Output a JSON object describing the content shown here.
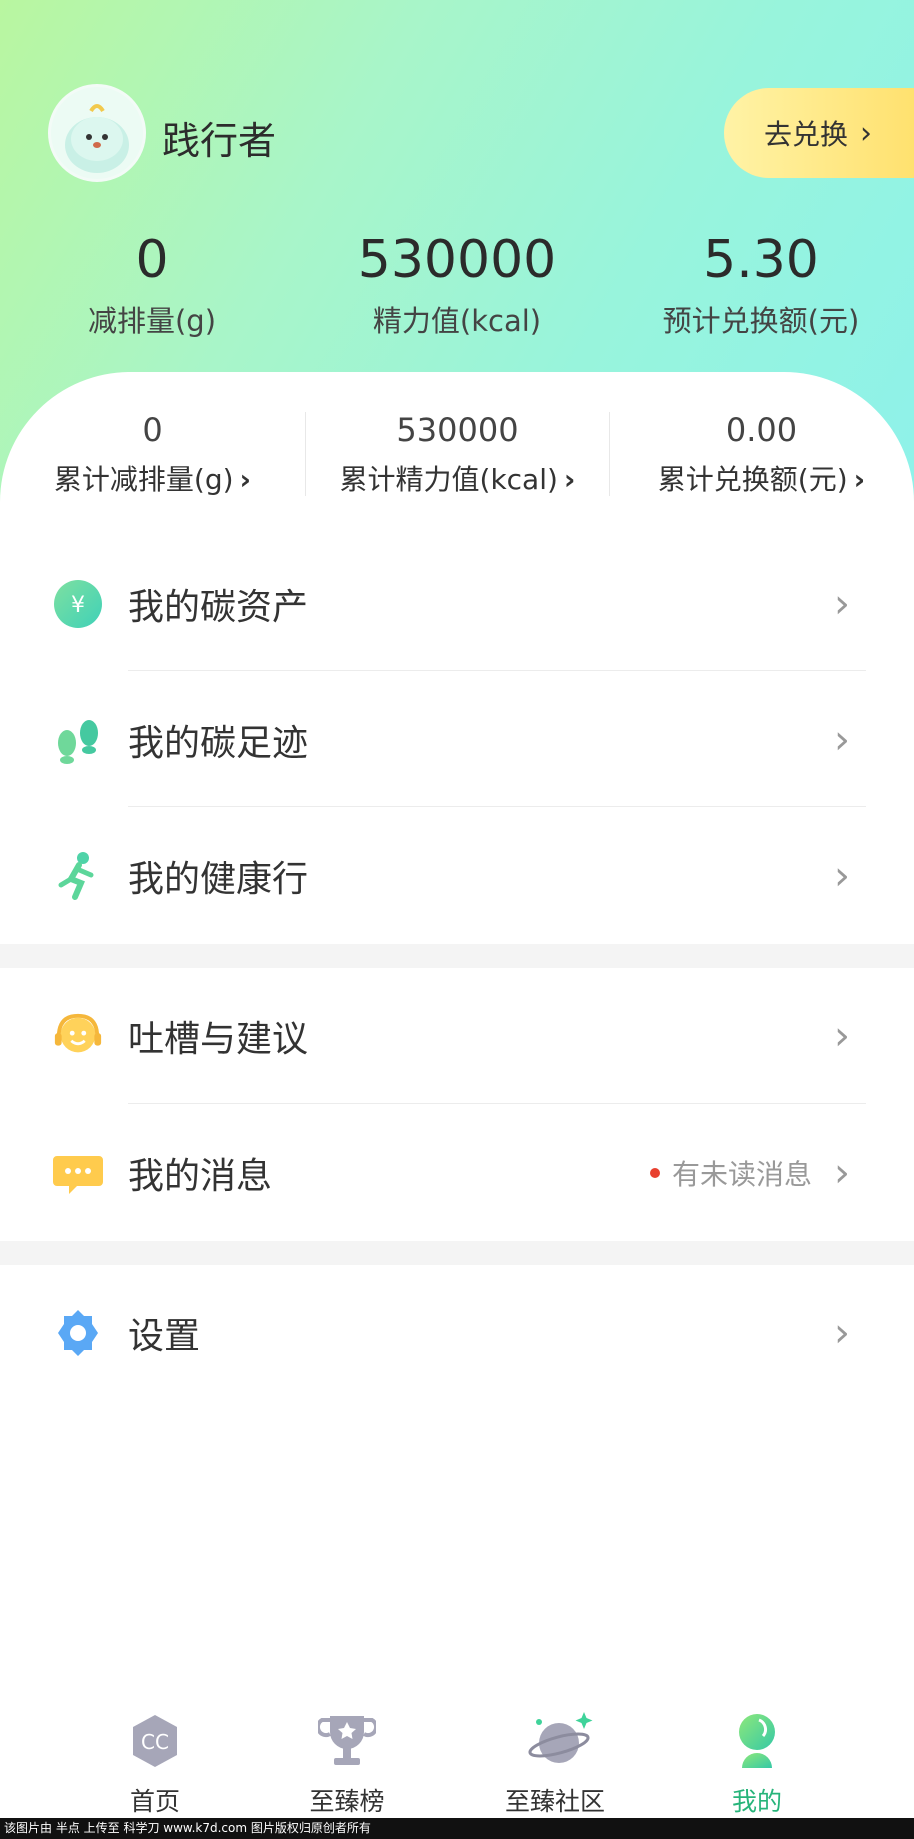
{
  "header": {
    "username": "践行者",
    "redeem_label": "去兑换",
    "colors": {
      "gradient_start": "#b9f6a0",
      "gradient_end": "#8ef2ea",
      "redeem": "#ffe06c"
    }
  },
  "stats": [
    {
      "value": "0",
      "label": "减排量(g)"
    },
    {
      "value": "530000",
      "label": "精力值(kcal)"
    },
    {
      "value": "5.30",
      "label": "预计兑换额(元)"
    }
  ],
  "cumulative": [
    {
      "value": "0",
      "label": "累计减排量(g)"
    },
    {
      "value": "530000",
      "label": "累计精力值(kcal)"
    },
    {
      "value": "0.00",
      "label": "累计兑换额(元)"
    }
  ],
  "menu_group1": [
    {
      "label": "我的碳资产",
      "icon": "yuan-coin-icon"
    },
    {
      "label": "我的碳足迹",
      "icon": "footprint-icon"
    },
    {
      "label": "我的健康行",
      "icon": "running-person-icon"
    }
  ],
  "menu_group2": [
    {
      "label": "吐槽与建议",
      "icon": "headset-smiley-icon"
    },
    {
      "label": "我的消息",
      "icon": "chat-bubble-icon",
      "badge": "有未读消息"
    }
  ],
  "menu_group3": [
    {
      "label": "设置",
      "icon": "gear-icon"
    }
  ],
  "tabs": [
    {
      "label": "首页",
      "icon": "cc-home-icon"
    },
    {
      "label": "至臻榜",
      "icon": "trophy-icon"
    },
    {
      "label": "至臻社区",
      "icon": "planet-icon"
    },
    {
      "label": "我的",
      "icon": "profile-icon",
      "active": true
    }
  ],
  "footer_text": "该图片由 半点 上传至 科学刀 www.k7d.com 图片版权归原创者所有"
}
